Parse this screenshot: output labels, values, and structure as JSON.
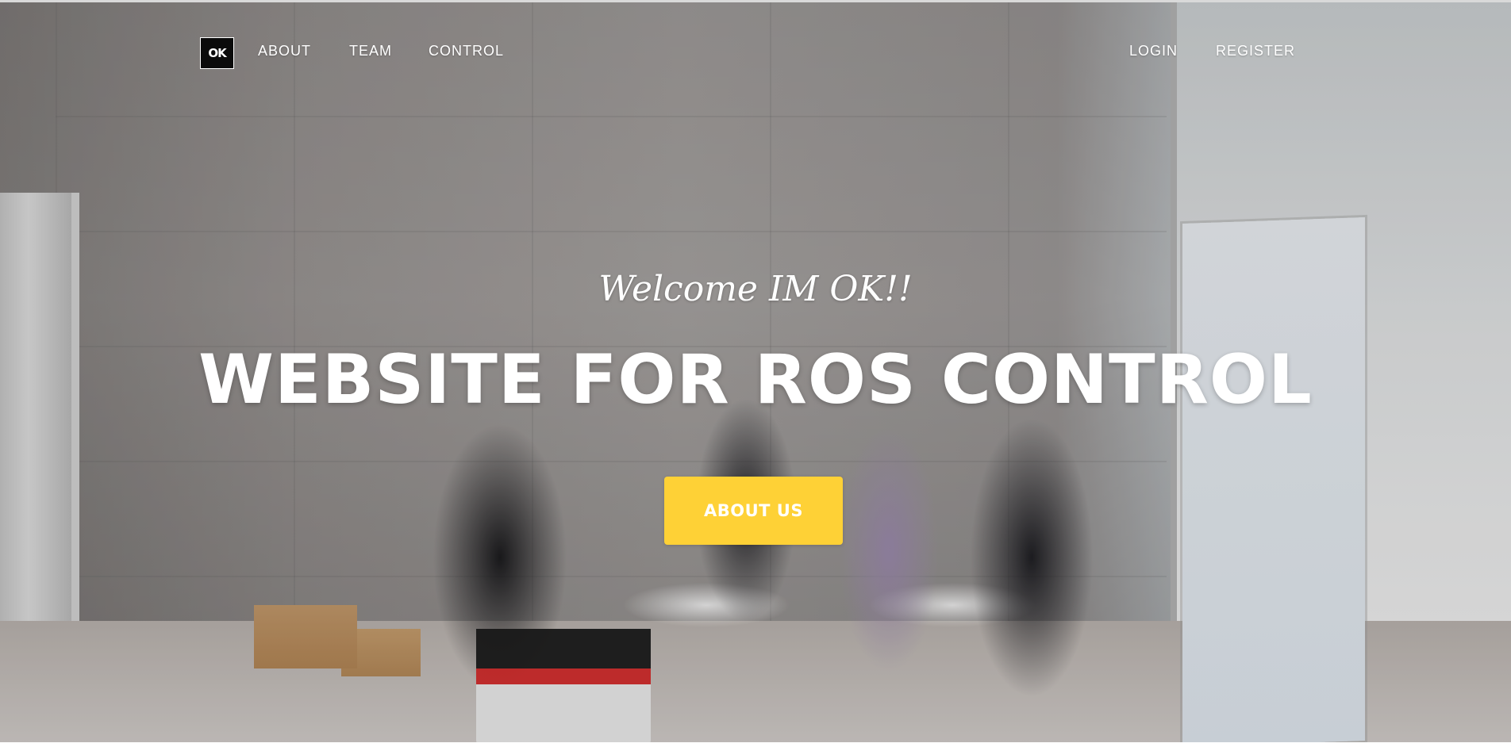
{
  "brand": {
    "logo_text": "OK",
    "logo_icon": "cat-ok-logo-icon"
  },
  "nav": {
    "left_items": [
      {
        "label": "ABOUT"
      },
      {
        "label": "TEAM"
      },
      {
        "label": "CONTROL"
      }
    ],
    "right_items": [
      {
        "label": "LOGIN"
      },
      {
        "label": "REGISTER"
      }
    ]
  },
  "hero": {
    "welcome": "Welcome IM OK!!",
    "headline": "WEBSITE FOR ROS CONTROL",
    "cta_label": "ABOUT US"
  },
  "colors": {
    "accent": "#fed136",
    "text_on_image": "#ffffff"
  }
}
